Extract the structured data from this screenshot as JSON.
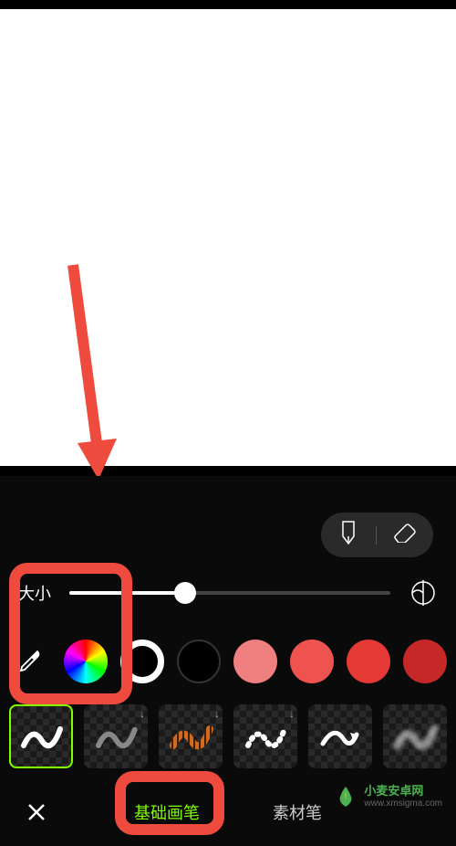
{
  "toolbar": {
    "pen_tool": "pen-tool",
    "eraser_tool": "eraser-tool"
  },
  "slider": {
    "label": "大小",
    "value_percent": 36
  },
  "colors": {
    "eyedropper": "eyedropper",
    "picker": "color-wheel",
    "selected": "#ffffff",
    "swatches": [
      "#000000",
      "#f08080",
      "#ef5350",
      "#e53935",
      "#c62828"
    ]
  },
  "brushes": {
    "selected_index": 0,
    "items": [
      {
        "name": "solid-brush",
        "has_download": false
      },
      {
        "name": "spray-brush",
        "has_download": true
      },
      {
        "name": "tiger-brush",
        "has_download": true
      },
      {
        "name": "dotted-brush",
        "has_download": true
      },
      {
        "name": "arrow-brush",
        "has_download": false
      },
      {
        "name": "soft-brush",
        "has_download": false
      }
    ]
  },
  "tabs": {
    "tab1_label": "基础画笔",
    "tab2_label": "素材笔",
    "active_index": 0
  },
  "watermark": {
    "text_line1": "小麦安卓网",
    "text_line2": "www.xmsigma.com"
  }
}
